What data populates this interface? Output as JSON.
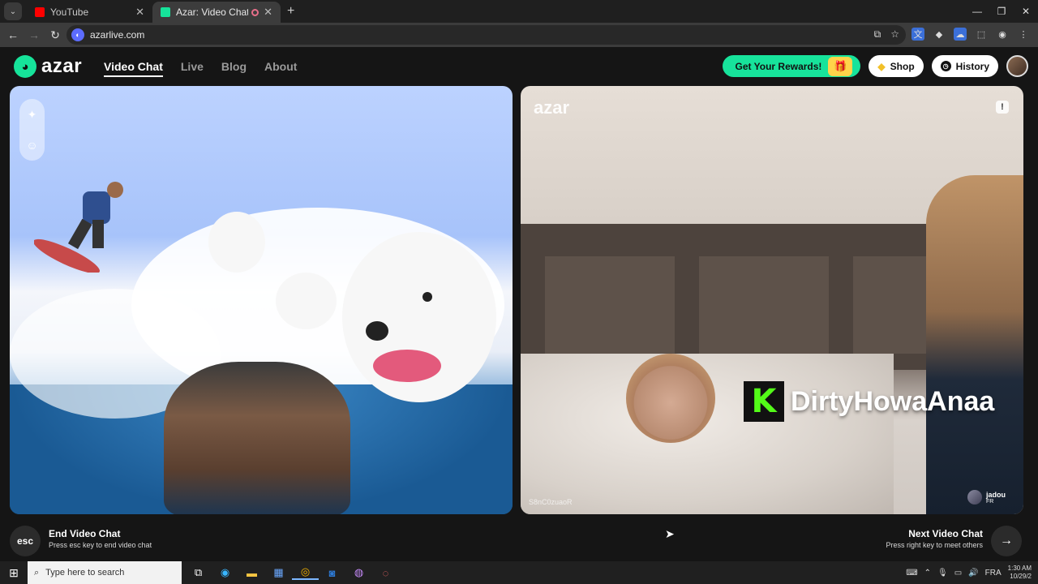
{
  "browser": {
    "tabs": [
      {
        "title": "YouTube",
        "favicon_color": "#ff0000",
        "active": false
      },
      {
        "title": "Azar: Video Chat with New",
        "favicon_color": "#16e39a",
        "active": true
      }
    ],
    "new_tab_symbol": "+",
    "url": "azarlive.com"
  },
  "azar": {
    "logo_text": "azar",
    "nav": [
      {
        "label": "Video Chat",
        "active": true
      },
      {
        "label": "Live"
      },
      {
        "label": "Blog"
      },
      {
        "label": "About"
      }
    ],
    "rewards_label": "Get Your Rewards!",
    "shop_label": "Shop",
    "history_label": "History"
  },
  "remote_video": {
    "watermark": "azar",
    "stream_overlay_name": "DirtyHowaAnaa",
    "peer_id": "S8nC0zuaoR",
    "peer_name": "jadou",
    "peer_country": "FR"
  },
  "controls": {
    "esc_key": "esc",
    "end_title": "End Video Chat",
    "end_sub": "Press esc key to end video chat",
    "next_title": "Next Video Chat",
    "next_sub": "Press right key to meet others"
  },
  "taskbar": {
    "search_placeholder": "Type here to search",
    "lang": "FRA",
    "time": "1:30 AM",
    "date": "10/29/2"
  },
  "colors": {
    "accent": "#17e39b",
    "background": "#151515"
  }
}
